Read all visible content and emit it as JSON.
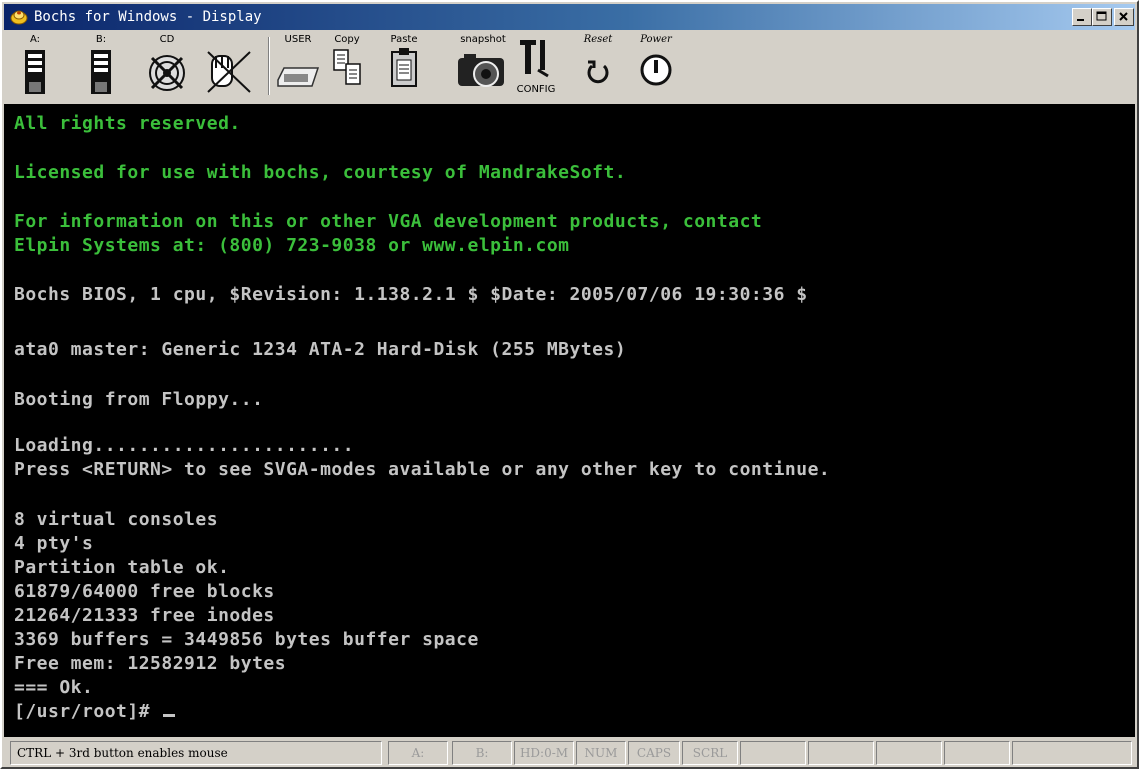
{
  "window": {
    "title": "Bochs for Windows - Display"
  },
  "toolbar": {
    "buttons": [
      {
        "label": "A:",
        "icon": "floppy-a-icon"
      },
      {
        "label": "B:",
        "icon": "floppy-b-icon"
      },
      {
        "label": "CD",
        "icon": "cdrom-icon"
      },
      {
        "label": "",
        "icon": "mouse-icon"
      },
      {
        "label": "USER",
        "icon": "keyboard-icon"
      },
      {
        "label": "Copy",
        "icon": "copy-icon"
      },
      {
        "label": "Paste",
        "icon": "paste-icon"
      },
      {
        "label": "snapshot",
        "icon": "camera-icon"
      },
      {
        "label": "CONFIG",
        "icon": "config-icon"
      },
      {
        "label": "Reset",
        "icon": "reset-icon"
      },
      {
        "label": "Power",
        "icon": "power-icon"
      }
    ]
  },
  "console": {
    "colors": {
      "green": "#3bbf3b",
      "gray": "#c4c4c4"
    },
    "lines": [
      "All rights reserved.",
      "",
      "Licensed for use with bochs, courtesy of MandrakeSoft.",
      "",
      "For information on this or other VGA development products, contact",
      "Elpin Systems at: (800) 723-9038 or www.elpin.com",
      "",
      "Bochs BIOS, 1 cpu, $Revision: 1.138.2.1 $ $Date: 2005/07/06 19:30:36 $",
      "",
      "ata0 master: Generic 1234 ATA-2 Hard-Disk (255 MBytes)",
      "",
      "Booting from Floppy...",
      "",
      "Loading.......................",
      "Press <RETURN> to see SVGA-modes available or any other key to continue.",
      "",
      "8 virtual consoles",
      "4 pty's",
      "Partition table ok.",
      "61879/64000 free blocks",
      "21264/21333 free inodes",
      "3369 buffers = 3449856 bytes buffer space",
      "Free mem: 12582912 bytes",
      "=== Ok.",
      "[/usr/root]# "
    ]
  },
  "statusbar": {
    "message": "CTRL + 3rd button enables mouse",
    "indicators": [
      "A:",
      "B:",
      "HD:0-M",
      "NUM",
      "CAPS",
      "SCRL"
    ]
  }
}
